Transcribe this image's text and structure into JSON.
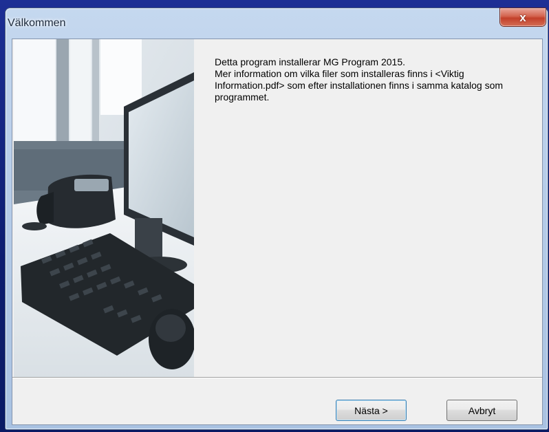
{
  "window": {
    "title": "Välkommen",
    "close_glyph": "x"
  },
  "content": {
    "line1": "Detta program installerar MG Program 2015.",
    "line2": "Mer information om vilka filer som installeras finns i <Viktig Information.pdf> som efter installationen finns i samma katalog som programmet."
  },
  "buttons": {
    "next_label": "Nästa >",
    "cancel_label": "Avbryt"
  },
  "image": {
    "description_icon": "office-desk-photo"
  },
  "colors": {
    "desktop": "#1d2f95",
    "close_button": "#c2402a",
    "dialog_background": "#f0f0f0"
  }
}
